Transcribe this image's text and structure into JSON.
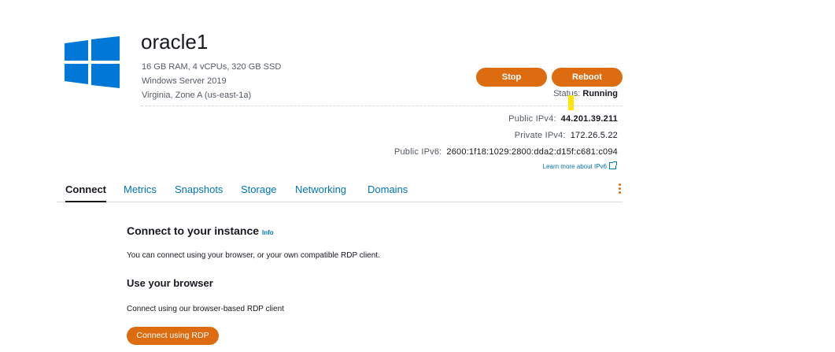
{
  "instance": {
    "name": "oracle1",
    "specs": "16 GB RAM, 4 vCPUs, 320 GB SSD",
    "os": "Windows Server 2019",
    "location": "Virginia, Zone A (us-east-1a)",
    "logo_icon": "windows-logo-icon",
    "logo_color": "#0078d7"
  },
  "actions": {
    "stop_label": "Stop",
    "reboot_label": "Reboot",
    "button_color": "#dd6b10"
  },
  "status": {
    "label": "Status:",
    "value": "Running"
  },
  "network": {
    "public_ipv4_label": "Public IPv4:",
    "public_ipv4": "44.201.39.211",
    "private_ipv4_label": "Private IPv4:",
    "private_ipv4": "172.26.5.22",
    "public_ipv6_label": "Public IPv6:",
    "public_ipv6": "2600:1f18:1029:2800:dda2:d15f:c681:c094",
    "learn_more": "Learn more about IPv6"
  },
  "tabs": [
    {
      "label": "Connect",
      "active": true
    },
    {
      "label": "Metrics"
    },
    {
      "label": "Snapshots"
    },
    {
      "label": "Storage"
    },
    {
      "label": "Networking"
    },
    {
      "label": "Domains"
    }
  ],
  "connect": {
    "heading": "Connect to your instance",
    "info_label": "Info",
    "intro": "You can connect using your browser, or your own compatible RDP client.",
    "browser_heading": "Use your browser",
    "browser_desc": "Connect using our browser-based RDP client",
    "rdp_button": "Connect using RDP"
  }
}
